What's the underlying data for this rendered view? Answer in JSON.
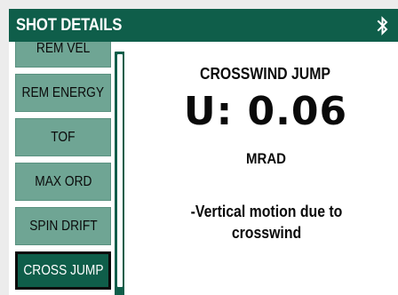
{
  "header": {
    "title": "SHOT DETAILS",
    "icon": "bluetooth-icon"
  },
  "sidebar": {
    "items": [
      {
        "label": "REM VEL",
        "active": false
      },
      {
        "label": "REM ENERGY",
        "active": false
      },
      {
        "label": "TOF",
        "active": false
      },
      {
        "label": "MAX ORD",
        "active": false
      },
      {
        "label": "SPIN DRIFT",
        "active": false
      },
      {
        "label": "CROSS JUMP",
        "active": true
      }
    ]
  },
  "detail": {
    "title": "CROSSWIND JUMP",
    "value": "U: 0.06",
    "unit": "MRAD",
    "description": "-Vertical motion due to crosswind"
  },
  "colors": {
    "accent": "#0f5e4a",
    "item": "#6fa594",
    "background": "#ececec"
  }
}
